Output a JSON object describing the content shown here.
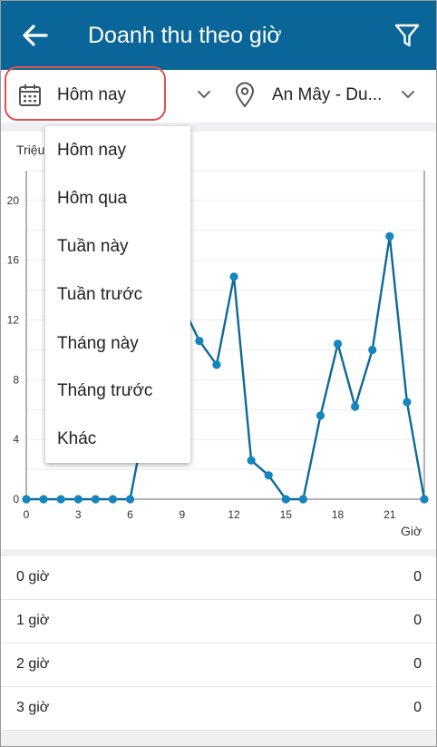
{
  "header": {
    "title": "Doanh thu theo giờ",
    "back_icon": "arrow-left-icon",
    "filter_icon": "funnel-icon",
    "background": "#0a6699"
  },
  "filters": {
    "date": "Hôm nay",
    "store": "An Mây - Du...",
    "highlight_color": "#e05050"
  },
  "date_menu": {
    "options": [
      "Hôm nay",
      "Hôm qua",
      "Tuần này",
      "Tuần trước",
      "Tháng này",
      "Tháng trước",
      "Khác"
    ]
  },
  "chart_data": {
    "type": "line",
    "ylabel": "Triệu",
    "xlabel": "Giờ",
    "x_ticks": [
      "0",
      "3",
      "6",
      "9",
      "12",
      "15",
      "18",
      "21"
    ],
    "y_ticks": [
      "0",
      "4",
      "8",
      "12",
      "16",
      "20"
    ],
    "xlim": [
      0,
      23
    ],
    "ylim": [
      0,
      22
    ],
    "grid": true,
    "color": "#0e6a96",
    "x": [
      0,
      1,
      2,
      3,
      4,
      5,
      6,
      7,
      8,
      9,
      10,
      11,
      12,
      13,
      14,
      15,
      16,
      17,
      18,
      19,
      20,
      21,
      22,
      23
    ],
    "values": [
      0,
      0,
      0,
      0,
      0,
      0,
      0,
      6,
      17,
      13,
      10.6,
      9,
      14.9,
      2.6,
      1.6,
      0,
      0,
      5.6,
      10.4,
      6.2,
      10,
      17.6,
      6.5,
      0
    ]
  },
  "list": {
    "rows": [
      {
        "label": "0 giờ",
        "value": "0"
      },
      {
        "label": "1 giờ",
        "value": "0"
      },
      {
        "label": "2 giờ",
        "value": "0"
      },
      {
        "label": "3 giờ",
        "value": "0"
      }
    ]
  }
}
